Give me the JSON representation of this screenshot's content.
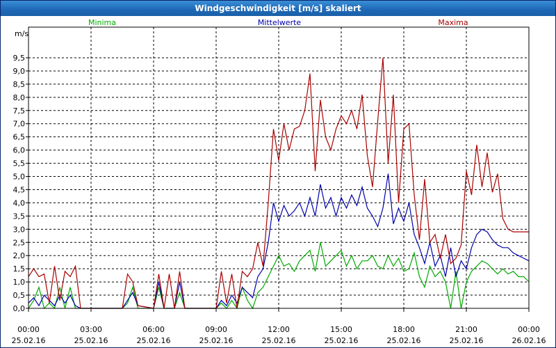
{
  "window": {
    "title": "Windgeschwindigkeit [m/s] skaliert"
  },
  "colors": {
    "minima": "#00aa00",
    "mittelwerte": "#0000aa",
    "maxima": "#aa0000",
    "grid": "#000000"
  },
  "chart_data": {
    "type": "line",
    "title": "Windgeschwindigkeit [m/s] skaliert",
    "ylabel": "m/s",
    "ylim": [
      0,
      9.5
    ],
    "yticks": [
      "0,0",
      "0,5",
      "1,0",
      "1,5",
      "2,0",
      "2,5",
      "3,0",
      "3,5",
      "4,0",
      "4,5",
      "5,0",
      "5,5",
      "6,0",
      "6,5",
      "7,0",
      "7,5",
      "8,0",
      "8,5",
      "9,0",
      "9,5"
    ],
    "xlim": [
      0,
      24
    ],
    "xticks": [
      {
        "time": "00:00",
        "date": "25.02.16"
      },
      {
        "time": "03:00",
        "date": "25.02.16"
      },
      {
        "time": "06:00",
        "date": "25.02.16"
      },
      {
        "time": "09:00",
        "date": "25.02.16"
      },
      {
        "time": "12:00",
        "date": "25.02.16"
      },
      {
        "time": "15:00",
        "date": "25.02.16"
      },
      {
        "time": "18:00",
        "date": "25.02.16"
      },
      {
        "time": "21:00",
        "date": "25.02.16"
      },
      {
        "time": "00:00",
        "date": "26.02.16"
      }
    ],
    "grid": true,
    "legend_placement": "top",
    "series": [
      {
        "name": "Minima",
        "color": "#00aa00",
        "x": [
          0,
          0.25,
          0.5,
          0.75,
          1.0,
          1.25,
          1.5,
          1.75,
          2.0,
          2.25,
          2.5,
          3.0,
          4.5,
          4.75,
          5.0,
          5.25,
          6.0,
          6.25,
          6.5,
          6.75,
          7.0,
          7.25,
          7.5,
          7.75,
          8.0,
          8.25,
          9.0,
          9.25,
          9.5,
          9.75,
          10.0,
          10.25,
          10.5,
          10.75,
          11.0,
          11.25,
          11.5,
          11.75,
          12.0,
          12.25,
          12.5,
          12.75,
          13.0,
          13.25,
          13.5,
          13.75,
          14.0,
          14.25,
          14.5,
          14.75,
          15.0,
          15.25,
          15.5,
          15.75,
          16.0,
          16.25,
          16.5,
          16.75,
          17.0,
          17.25,
          17.5,
          17.75,
          18.0,
          18.25,
          18.5,
          18.75,
          19.0,
          19.25,
          19.5,
          19.75,
          20.0,
          20.25,
          20.5,
          20.75,
          21.0,
          21.25,
          21.5,
          21.75,
          22.0,
          22.25,
          22.5,
          22.75,
          23.0,
          23.25,
          23.5,
          23.75,
          24.0
        ],
        "values": [
          0.0,
          0.3,
          0.8,
          0.0,
          0.2,
          0.0,
          0.8,
          0.0,
          0.8,
          0.0,
          0.0,
          0.0,
          0.0,
          0.2,
          0.8,
          0.0,
          0.0,
          0.8,
          0.0,
          0.0,
          0.0,
          0.6,
          0.0,
          0.0,
          0.0,
          0.0,
          0.0,
          0.2,
          0.0,
          0.3,
          0.0,
          0.8,
          0.3,
          0.0,
          0.6,
          0.8,
          1.2,
          1.6,
          2.0,
          1.6,
          1.7,
          1.4,
          1.8,
          2.0,
          2.2,
          1.4,
          2.5,
          1.6,
          1.8,
          2.0,
          2.2,
          1.6,
          2.0,
          1.5,
          1.8,
          1.8,
          2.0,
          1.6,
          1.5,
          2.0,
          1.6,
          1.9,
          1.4,
          1.5,
          2.1,
          1.2,
          0.8,
          1.6,
          1.2,
          1.4,
          1.0,
          0.0,
          1.4,
          0.0,
          1.0,
          1.4,
          1.6,
          1.8,
          1.7,
          1.5,
          1.3,
          1.5,
          1.3,
          1.4,
          1.2,
          1.2,
          1.0
        ]
      },
      {
        "name": "Mittelwerte",
        "color": "#0000aa",
        "x": [
          0,
          0.25,
          0.5,
          0.75,
          1.0,
          1.25,
          1.5,
          1.75,
          2.0,
          2.25,
          2.5,
          3.0,
          4.5,
          4.75,
          5.0,
          5.25,
          6.0,
          6.25,
          6.5,
          6.75,
          7.0,
          7.25,
          7.5,
          7.75,
          8.0,
          8.25,
          9.0,
          9.25,
          9.5,
          9.75,
          10.0,
          10.25,
          10.5,
          10.75,
          11.0,
          11.25,
          11.5,
          11.75,
          12.0,
          12.25,
          12.5,
          12.75,
          13.0,
          13.25,
          13.5,
          13.75,
          14.0,
          14.25,
          14.5,
          14.75,
          15.0,
          15.25,
          15.5,
          15.75,
          16.0,
          16.25,
          16.5,
          16.75,
          17.0,
          17.25,
          17.5,
          17.75,
          18.0,
          18.25,
          18.5,
          18.75,
          19.0,
          19.25,
          19.5,
          19.75,
          20.0,
          20.25,
          20.5,
          20.75,
          21.0,
          21.25,
          21.5,
          21.75,
          22.0,
          22.25,
          22.5,
          22.75,
          23.0,
          23.25,
          23.5,
          23.75,
          24.0
        ],
        "values": [
          0.2,
          0.4,
          0.1,
          0.5,
          0.3,
          0.1,
          0.5,
          0.2,
          0.5,
          0.1,
          0.0,
          0.0,
          0.0,
          0.3,
          0.6,
          0.1,
          0.0,
          1.0,
          0.0,
          0.0,
          0.0,
          1.0,
          0.0,
          0.0,
          0.0,
          0.0,
          0.0,
          0.3,
          0.1,
          0.5,
          0.2,
          0.8,
          0.6,
          0.4,
          1.2,
          1.5,
          2.5,
          4.0,
          3.3,
          3.9,
          3.5,
          3.7,
          4.0,
          3.5,
          4.2,
          3.5,
          4.7,
          3.8,
          4.2,
          3.5,
          4.2,
          3.8,
          4.3,
          3.9,
          4.6,
          3.8,
          3.5,
          3.1,
          3.8,
          5.1,
          3.2,
          3.8,
          3.3,
          4.0,
          2.8,
          2.3,
          1.7,
          2.5,
          1.6,
          2.0,
          1.2,
          2.3,
          1.2,
          1.8,
          1.5,
          2.3,
          2.8,
          3.0,
          2.9,
          2.6,
          2.4,
          2.3,
          2.3,
          2.1,
          2.0,
          1.9,
          1.8
        ]
      },
      {
        "name": "Maxima",
        "color": "#aa0000",
        "x": [
          0,
          0.25,
          0.5,
          0.75,
          1.0,
          1.25,
          1.5,
          1.75,
          2.0,
          2.25,
          2.5,
          3.0,
          4.5,
          4.75,
          5.0,
          5.25,
          6.0,
          6.25,
          6.5,
          6.75,
          7.0,
          7.25,
          7.5,
          7.75,
          8.0,
          8.25,
          9.0,
          9.25,
          9.5,
          9.75,
          10.0,
          10.25,
          10.5,
          10.75,
          11.0,
          11.25,
          11.5,
          11.75,
          12.0,
          12.25,
          12.5,
          12.75,
          13.0,
          13.25,
          13.5,
          13.75,
          14.0,
          14.25,
          14.5,
          14.75,
          15.0,
          15.25,
          15.5,
          15.75,
          16.0,
          16.25,
          16.5,
          16.75,
          17.0,
          17.25,
          17.5,
          17.75,
          18.0,
          18.25,
          18.5,
          18.75,
          19.0,
          19.25,
          19.5,
          19.75,
          20.0,
          20.25,
          20.5,
          20.75,
          21.0,
          21.25,
          21.5,
          21.75,
          22.0,
          22.25,
          22.5,
          22.75,
          23.0,
          23.25,
          23.5,
          23.75,
          24.0
        ],
        "values": [
          1.2,
          1.5,
          1.2,
          1.3,
          0.2,
          1.6,
          0.3,
          1.4,
          1.2,
          1.6,
          0.0,
          0.0,
          0.0,
          1.3,
          1.0,
          0.1,
          0.0,
          1.3,
          0.0,
          1.3,
          0.0,
          1.4,
          0.0,
          0.0,
          0.0,
          0.0,
          0.0,
          1.4,
          0.2,
          1.3,
          0.0,
          1.4,
          1.2,
          1.5,
          2.5,
          1.6,
          4.0,
          6.8,
          5.6,
          7.0,
          6.0,
          6.8,
          6.9,
          7.5,
          8.9,
          5.2,
          7.9,
          6.5,
          6.0,
          6.8,
          7.3,
          7.0,
          7.5,
          6.8,
          8.1,
          5.8,
          4.6,
          7.1,
          9.5,
          5.5,
          8.1,
          4.0,
          6.8,
          7.0,
          4.3,
          2.6,
          4.9,
          2.5,
          2.8,
          1.9,
          2.8,
          1.7,
          1.9,
          2.4,
          5.2,
          4.3,
          6.2,
          4.6,
          5.9,
          4.4,
          5.1,
          3.4,
          3.0,
          2.9,
          2.9,
          2.9,
          2.9
        ]
      }
    ]
  }
}
